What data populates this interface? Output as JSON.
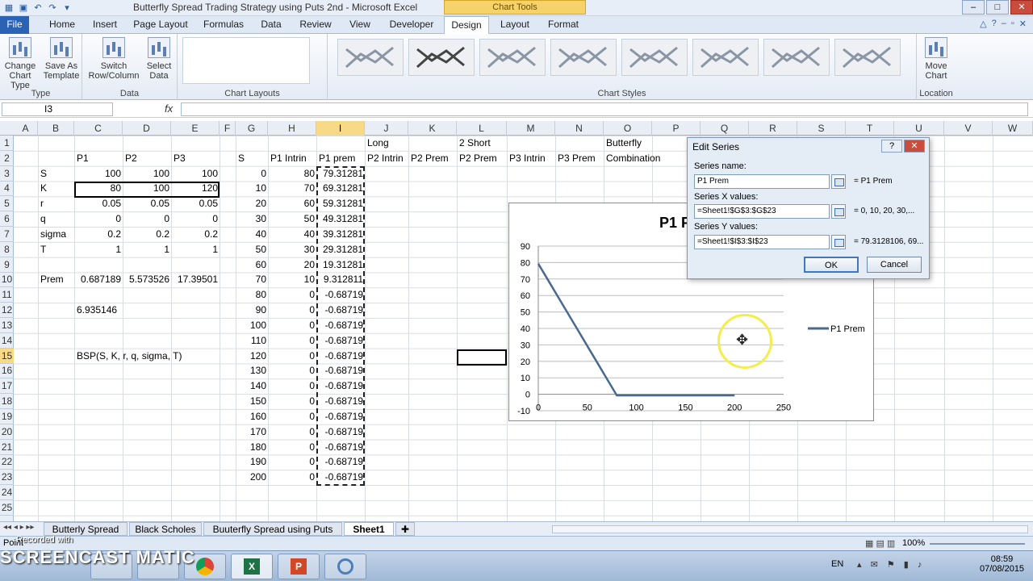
{
  "app": {
    "title": "Butterfly Spread Trading Strategy using Puts 2nd  -  Microsoft Excel",
    "chart_tools_label": "Chart Tools"
  },
  "ribbon_tabs": [
    "File",
    "Home",
    "Insert",
    "Page Layout",
    "Formulas",
    "Data",
    "Review",
    "View",
    "Developer",
    "Design",
    "Layout",
    "Format"
  ],
  "ribbon": {
    "type_group": {
      "label": "Type",
      "change_chart_type": "Change Chart Type",
      "save_as_template": "Save As Template"
    },
    "data_group": {
      "label": "Data",
      "switch_row_column": "Switch Row/Column",
      "select_data": "Select Data"
    },
    "chart_layouts_label": "Chart Layouts",
    "chart_styles_label": "Chart Styles",
    "location_group": {
      "label": "Location",
      "move_chart": "Move Chart"
    }
  },
  "formula_bar": {
    "name_box": "I3",
    "fx": "fx",
    "formula": ""
  },
  "columns": [
    "A",
    "B",
    "C",
    "D",
    "E",
    "F",
    "G",
    "H",
    "I",
    "J",
    "K",
    "L",
    "M",
    "N",
    "O",
    "P",
    "Q",
    "R",
    "S",
    "T",
    "U",
    "V",
    "W"
  ],
  "rows": [
    "1",
    "2",
    "3",
    "4",
    "5",
    "6",
    "7",
    "8",
    "9",
    "10",
    "11",
    "12",
    "13",
    "14",
    "15",
    "16",
    "17",
    "18",
    "19",
    "20",
    "21",
    "22",
    "23",
    "24",
    "25"
  ],
  "cells": {
    "J1": "Long",
    "L1": "2 Short",
    "O1": "Butterfly",
    "C2": "P1",
    "D2": "P2",
    "E2": "P3",
    "G2": "S",
    "H2": "P1 Intrin",
    "I2": "P1 prem",
    "J2": "P2 Intrin",
    "K2": "P2 Prem",
    "L2": "P2 Prem",
    "M2": "P3 Intrin",
    "N2": "P3 Prem",
    "O2": "Combination",
    "B3": "S",
    "C3": "100",
    "D3": "100",
    "E3": "100",
    "B4": "K",
    "C4": "80",
    "D4": "100",
    "E4": "120",
    "B5": "r",
    "C5": "0.05",
    "D5": "0.05",
    "E5": "0.05",
    "B6": "q",
    "C6": "0",
    "D6": "0",
    "E6": "0",
    "B7": "sigma",
    "C7": "0.2",
    "D7": "0.2",
    "E7": "0.2",
    "B8": "T",
    "C8": "1",
    "D8": "1",
    "E8": "1",
    "B10": "Prem",
    "C10": "0.687189",
    "D10": "5.573526",
    "E10": "17.39501",
    "C12": "6.935146",
    "C15": "BSP(S, K, r, q, sigma, T)"
  },
  "table_s": [
    "0",
    "10",
    "20",
    "30",
    "40",
    "50",
    "60",
    "70",
    "80",
    "90",
    "100",
    "110",
    "120",
    "130",
    "140",
    "150",
    "160",
    "170",
    "180",
    "190",
    "200"
  ],
  "table_intrin": [
    "80",
    "70",
    "60",
    "50",
    "40",
    "30",
    "20",
    "10",
    "0",
    "0",
    "0",
    "0",
    "0",
    "0",
    "0",
    "0",
    "0",
    "0",
    "0",
    "0",
    "0"
  ],
  "table_prem": [
    "79.31281",
    "69.31281",
    "59.31281",
    "49.31281",
    "39.31281",
    "29.31281",
    "19.31281",
    "9.312811",
    "-0.68719",
    "-0.68719",
    "-0.68719",
    "-0.68719",
    "-0.68719",
    "-0.68719",
    "-0.68719",
    "-0.68719",
    "-0.68719",
    "-0.68719",
    "-0.68719",
    "-0.68719",
    "-0.68719"
  ],
  "chart_data": {
    "type": "line",
    "title": "P1 P",
    "x": [
      0,
      10,
      20,
      30,
      40,
      50,
      60,
      70,
      80,
      90,
      100,
      110,
      120,
      130,
      140,
      150,
      160,
      170,
      180,
      190,
      200
    ],
    "series": [
      {
        "name": "P1 Prem",
        "values": [
          79.31281,
          69.31281,
          59.31281,
          49.31281,
          39.31281,
          29.31281,
          19.31281,
          9.312811,
          -0.68719,
          -0.68719,
          -0.68719,
          -0.68719,
          -0.68719,
          -0.68719,
          -0.68719,
          -0.68719,
          -0.68719,
          -0.68719,
          -0.68719,
          -0.68719,
          -0.68719
        ]
      }
    ],
    "x_ticks": [
      "0",
      "50",
      "100",
      "150",
      "200",
      "250"
    ],
    "y_ticks": [
      "90",
      "80",
      "70",
      "60",
      "50",
      "40",
      "30",
      "20",
      "10",
      "0",
      "-10"
    ],
    "xlim": [
      0,
      250
    ],
    "ylim": [
      -10,
      90
    ],
    "grid": true,
    "legend": "right",
    "line_color": "#4a6990"
  },
  "dialog": {
    "title": "Edit Series",
    "help": "?",
    "close": "✕",
    "series_name_label": "Series name:",
    "series_name_value": "P1 Prem",
    "series_name_result": "= P1 Prem",
    "x_label": "Series X values:",
    "x_value": "=Sheet1!$G$3:$G$23",
    "x_result": "= 0, 10, 20, 30,...",
    "y_label": "Series Y values:",
    "y_value": "=Sheet1!$I$3:$I$23",
    "y_result": "= 79.3128106, 69...",
    "ok": "OK",
    "cancel": "Cancel"
  },
  "sheet_tabs": [
    "Butterly Spread",
    "Black Scholes",
    "Buuterfly Spread using Puts",
    "Sheet1"
  ],
  "status": {
    "mode": "Point",
    "zoom": "100%"
  },
  "taskbar": {
    "lang": "EN",
    "time": "08:59",
    "date": "07/08/2015"
  },
  "watermark": {
    "recorded": "Recorded with",
    "brand": "SCREENCAST  MATIC"
  }
}
